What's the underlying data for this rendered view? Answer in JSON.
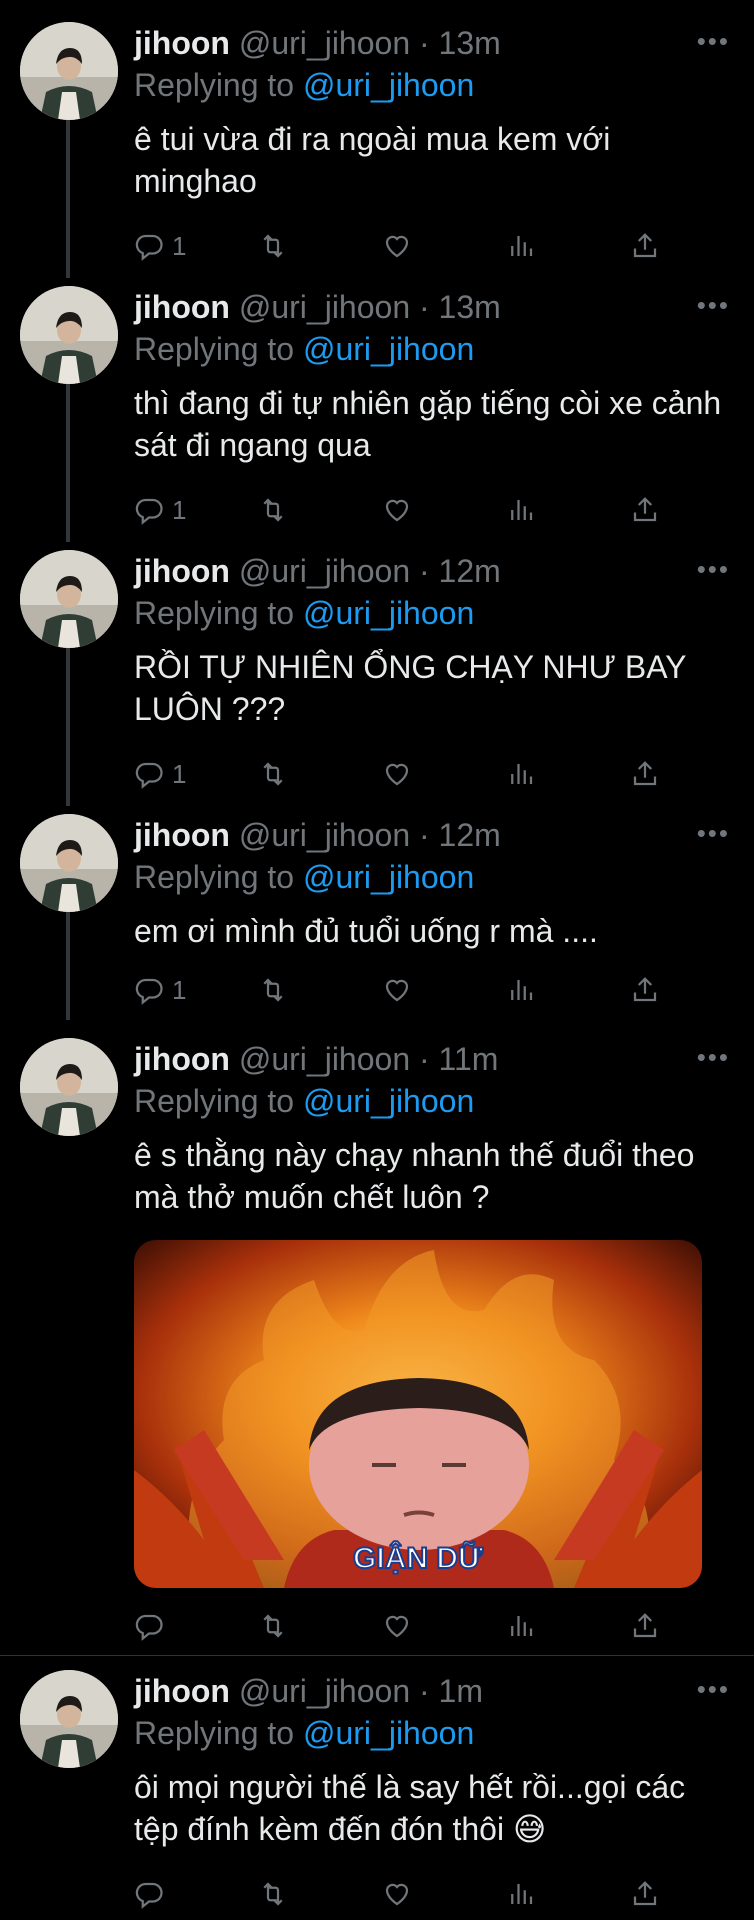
{
  "tweets": [
    {
      "name": "jihoon",
      "handle": "@uri_jihoon",
      "sep": "·",
      "time": "13m",
      "replying_prefix": "Replying to",
      "replying_handle": "@uri_jihoon",
      "text": "ê tui vừa đi ra ngoài mua kem với minghao",
      "reply_count": "1",
      "retweet_count": "",
      "like_count": ""
    },
    {
      "name": "jihoon",
      "handle": "@uri_jihoon",
      "sep": "·",
      "time": "13m",
      "replying_prefix": "Replying to",
      "replying_handle": "@uri_jihoon",
      "text": "thì đang đi tự nhiên gặp tiếng còi xe cảnh sát đi ngang qua",
      "reply_count": "1",
      "retweet_count": "",
      "like_count": ""
    },
    {
      "name": "jihoon",
      "handle": "@uri_jihoon",
      "sep": "·",
      "time": "12m",
      "replying_prefix": "Replying to",
      "replying_handle": "@uri_jihoon",
      "text": "RỒI TỰ NHIÊN ỔNG CHẠY NHƯ BAY LUÔN ???",
      "reply_count": "1",
      "retweet_count": "",
      "like_count": ""
    },
    {
      "name": "jihoon",
      "handle": "@uri_jihoon",
      "sep": "·",
      "time": "12m",
      "replying_prefix": "Replying to",
      "replying_handle": "@uri_jihoon",
      "text": "em ơi mình đủ tuổi uống r mà ....",
      "reply_count": "1",
      "retweet_count": "",
      "like_count": ""
    },
    {
      "name": "jihoon",
      "handle": "@uri_jihoon",
      "sep": "·",
      "time": "11m",
      "replying_prefix": "Replying to",
      "replying_handle": "@uri_jihoon",
      "text": "ê s thằng này chạy nhanh thế đuổi theo mà thở muốn chết luôn ?",
      "media_caption": "GIẬN DỮ",
      "reply_count": "",
      "retweet_count": "",
      "like_count": ""
    },
    {
      "name": "jihoon",
      "handle": "@uri_jihoon",
      "sep": "·",
      "time": "1m",
      "replying_prefix": "Replying to",
      "replying_handle": "@uri_jihoon",
      "text": "ôi mọi người thế là say hết rồi...gọi các tệp đính kèm đến đón thôi 😅",
      "reply_count": "",
      "retweet_count": "",
      "like_count": ""
    }
  ],
  "icons": {
    "reply": "reply-icon",
    "retweet": "retweet-icon",
    "like": "heart-icon",
    "analytics": "analytics-icon",
    "share": "share-icon",
    "more": "more-icon"
  },
  "colors": {
    "background": "#000000",
    "text": "#e7e9ea",
    "muted": "#71767b",
    "link": "#1d9bf0"
  }
}
